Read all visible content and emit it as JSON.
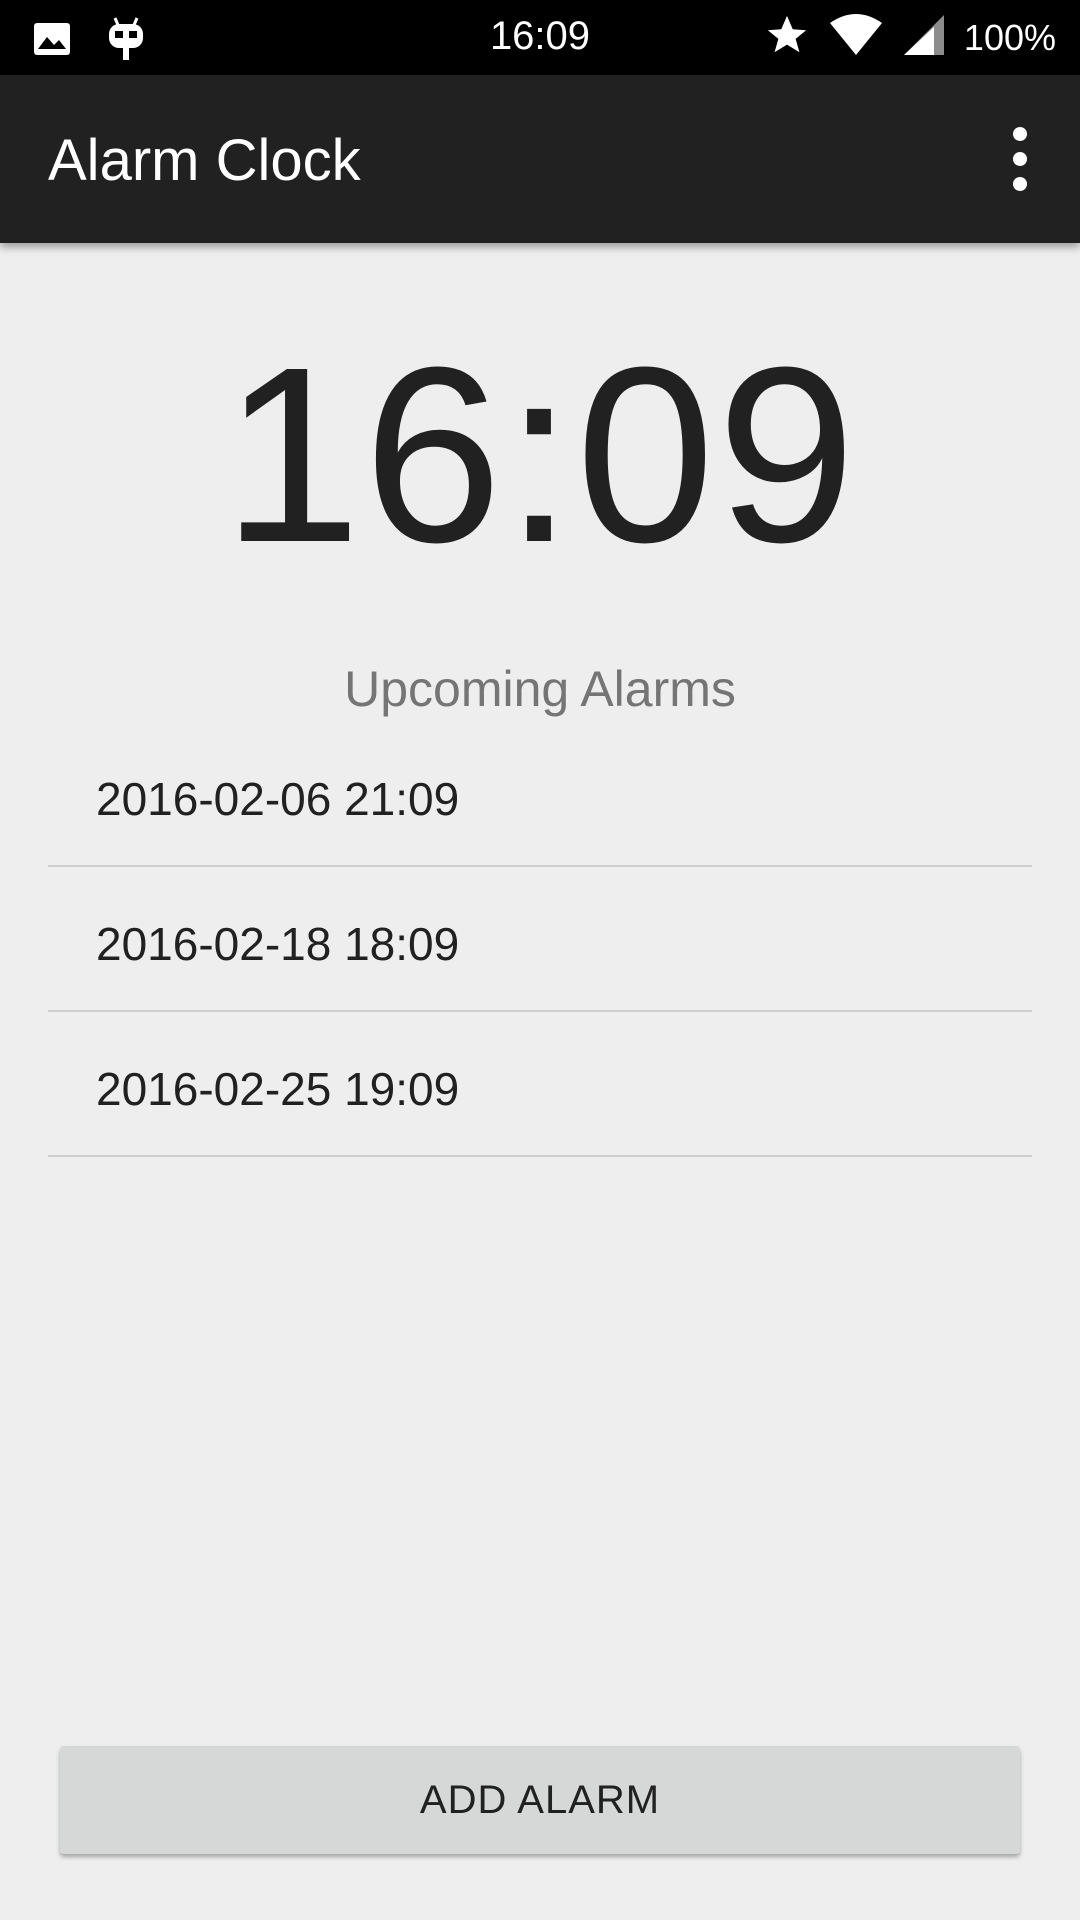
{
  "status_bar": {
    "time": "16:09",
    "battery": "100%",
    "left_icons": [
      "image-icon",
      "cyanogen-mod-icon"
    ],
    "right_icons": [
      "star-icon",
      "wifi-icon",
      "signal-icon"
    ]
  },
  "toolbar": {
    "title": "Alarm Clock",
    "overflow_icon": "more-vert-icon"
  },
  "main": {
    "current_time": "16:09",
    "section_title": "Upcoming Alarms",
    "alarms": [
      {
        "label": "2016-02-06 21:09"
      },
      {
        "label": "2016-02-18 18:09"
      },
      {
        "label": "2016-02-25 19:09"
      }
    ],
    "add_button_label": "ADD ALARM"
  },
  "colors": {
    "status_bar_bg": "#000000",
    "toolbar_bg": "#212121",
    "background": "#eeeeee",
    "primary_text": "#212121",
    "secondary_text": "#757575",
    "button_bg": "#d6d7d7"
  }
}
